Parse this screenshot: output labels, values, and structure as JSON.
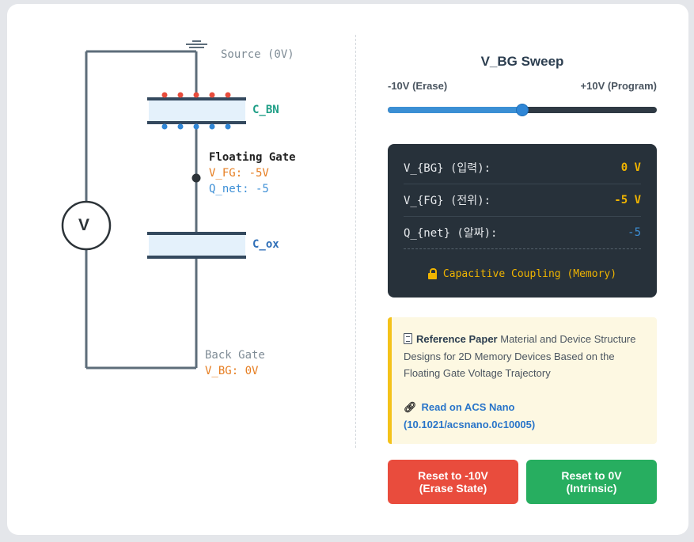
{
  "circuit": {
    "meter_symbol": "V",
    "source_label": "Source (0V)",
    "cbn_label": "C_BN",
    "floating_gate_title": "Floating Gate",
    "vfg_label": "V_FG: -5V",
    "qnet_label": "Q_net: -5",
    "cox_label": "C_ox",
    "back_gate_title": "Back Gate",
    "vbg_label": "V_BG: 0V"
  },
  "sweep": {
    "title": "V_BG Sweep",
    "min_label": "-10V (Erase)",
    "max_label": "+10V (Program)",
    "value_fraction": 0.5
  },
  "panel": {
    "rows": [
      {
        "label": "V_{BG} (입력):",
        "value": "0 V",
        "color": "#f0b400"
      },
      {
        "label": "V_{FG} (전위):",
        "value": "-5 V",
        "color": "#f0b400"
      },
      {
        "label": "Q_{net} (알짜):",
        "value": "-5",
        "color": "#3d8fd6"
      }
    ],
    "status": "Capacitive Coupling (Memory)"
  },
  "reference": {
    "heading": "Reference Paper",
    "body": " Material and Device Structure Designs for 2D Memory Devices Based on the Floating Gate Voltage Trajectory",
    "link_label": "Read on ACS Nano (10.1021/acsnano.0c10005)"
  },
  "buttons": {
    "erase_line1": "Reset to -10V",
    "erase_line2": "(Erase State)",
    "intrinsic_line1": "Reset to 0V",
    "intrinsic_line2": "(Intrinsic)"
  },
  "colors": {
    "source_label": "#7f8c96",
    "cbn_label": "#1e9e86",
    "accent_orange": "#e67e22",
    "accent_blue": "#3d8fd6",
    "charge_positive": "#e74c3c",
    "charge_negative": "#2f86d6"
  }
}
